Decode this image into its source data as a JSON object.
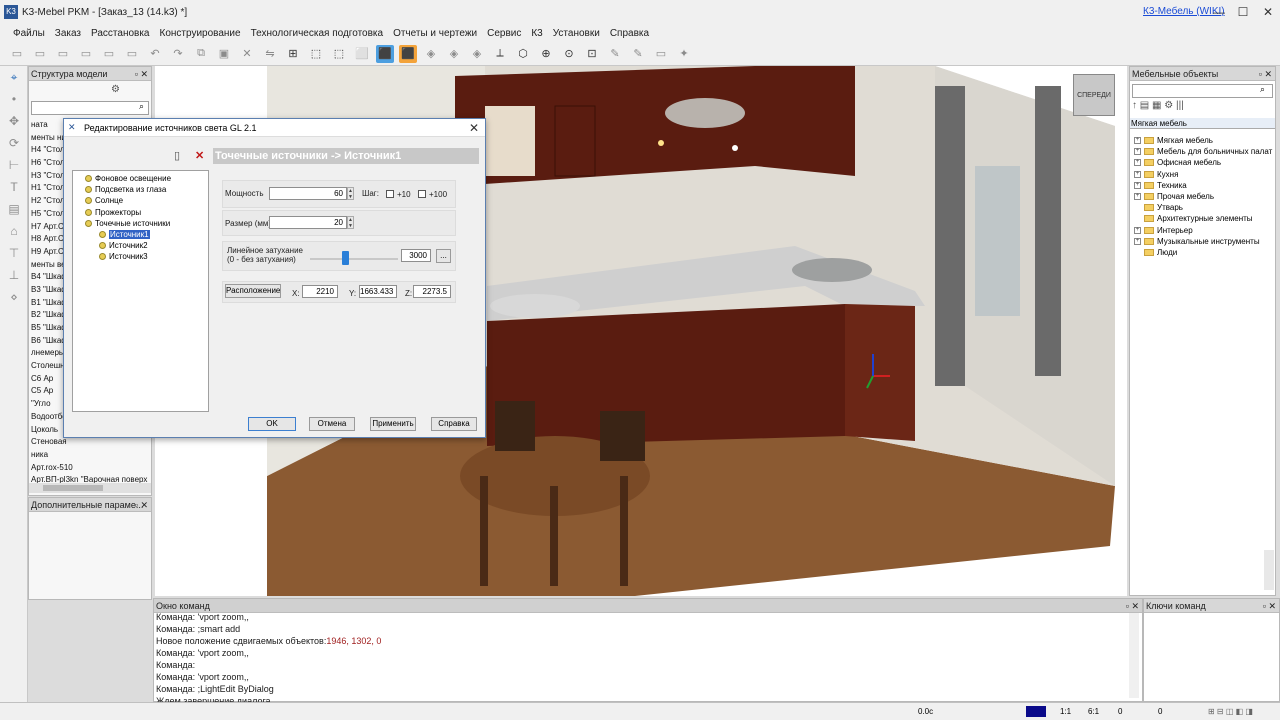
{
  "window": {
    "title": "K3-Mebel PKM - [Заказ_13 (14.k3) *]",
    "wiki_link": "К3-Мебель (WIKI)",
    "controls": [
      "—",
      "☐",
      "✕"
    ]
  },
  "menu": [
    "Файлы",
    "Заказ",
    "Расстановка",
    "Конструирование",
    "Технологическая подготовка",
    "Отчеты и чертежи",
    "Сервис",
    "К3",
    "Установки",
    "Справка"
  ],
  "toolbar_icons": [
    "new-icon",
    "open-icon",
    "save-icon",
    "save-as-icon",
    "print-icon",
    "cut-icon",
    "undo-icon",
    "redo-icon",
    "copy-icon",
    "paste-icon",
    "delete-icon",
    "mirror-icon",
    "grid-icon",
    "box-icon",
    "box-wire-icon",
    "box-solid-icon",
    "box-blue-icon",
    "box-orange-icon",
    "hide-icon",
    "show-icon",
    "layer-icon",
    "axis-icon",
    "cube-view-icon",
    "zoom-icon",
    "zoom-all-icon",
    "zoom-window-icon",
    "brush-icon",
    "pen-icon",
    "sheet-icon",
    "light-icon"
  ],
  "left_tools": [
    "cursor-icon",
    "dot-icon",
    "move-icon",
    "rotate-icon",
    "measure-icon",
    "text-icon",
    "layer-icon",
    "sofa-icon",
    "table-icon",
    "chair-icon",
    "snap-icon"
  ],
  "structure_panel": {
    "title": "Структура модели",
    "items": [
      "ната",
      "менты ни",
      "Н4 \"Стол",
      "Н6 \"Стол",
      "Н3 \"Стол",
      "Н1 \"Стол",
      "Н2 \"Стол",
      "Н5 \"Стол",
      "Н7 Арт.Ст",
      "Н8 Арт.Ст",
      "Н9 Арт.Ст",
      "менты ве",
      "В4 \"Шкаф",
      "В3 \"Шкаф",
      "В1 \"Шкаф",
      "В2 \"Шкаф",
      "В5 \"Шкаф",
      "В6 \"Шкаф",
      "лнемеры",
      "Столешни",
      "С6 Ар",
      "С5 Ар",
      "\"Угло",
      "Водоотбо",
      "Цоколь",
      "Стеновая",
      "ника",
      "Арт.rox-510",
      "Арт.ВП-pl3kn \"Варочная поверх"
    ]
  },
  "add_params_panel": {
    "title": "Дополнительные параме..."
  },
  "right_panel": {
    "title": "Мебельные объекты",
    "current": "Мягкая мебель",
    "items": [
      {
        "label": "Мягкая мебель",
        "expandable": true
      },
      {
        "label": "Мебель для больничных палат",
        "expandable": true
      },
      {
        "label": "Офисная мебель",
        "expandable": true
      },
      {
        "label": "Кухня",
        "expandable": true
      },
      {
        "label": "Техника",
        "expandable": true
      },
      {
        "label": "Прочая мебель",
        "expandable": true
      },
      {
        "label": "Утварь",
        "expandable": false
      },
      {
        "label": "Архитектурные элементы",
        "expandable": false
      },
      {
        "label": "Интерьер",
        "expandable": true
      },
      {
        "label": "Музыкальные инструменты",
        "expandable": true
      },
      {
        "label": "Люди",
        "expandable": false
      }
    ]
  },
  "viewcube": {
    "label": "СПЕРЕДИ"
  },
  "dialog": {
    "title": "Редактирование источников света GL 2.1",
    "header": "Точечные источники -> Источник1",
    "tree": [
      {
        "label": "Фоновое освещение",
        "indent": 0,
        "selected": false
      },
      {
        "label": "Подсветка из глаза",
        "indent": 0,
        "selected": false
      },
      {
        "label": "Солнце",
        "indent": 0,
        "selected": false
      },
      {
        "label": "Прожекторы",
        "indent": 0,
        "selected": false
      },
      {
        "label": "Точечные источники",
        "indent": 0,
        "selected": false
      },
      {
        "label": "Источник1",
        "indent": 1,
        "selected": true
      },
      {
        "label": "Источник2",
        "indent": 1,
        "selected": false
      },
      {
        "label": "Источник3",
        "indent": 1,
        "selected": false
      }
    ],
    "power_label": "Мощность",
    "power_value": "60",
    "step_label": "Шаг:",
    "step10": "+10",
    "step100": "+100",
    "size_label": "Размер (мм):",
    "size_value": "20",
    "attenuation_label_1": "Линейное затухание",
    "attenuation_label_2": "(0 - без затухания)",
    "attenuation_value": "3000",
    "attenuation_fraction": 0.4,
    "browse_label": "...",
    "position_button": "Расположение",
    "x_label": "X:",
    "x_value": "2210",
    "y_label": "Y:",
    "y_value": "1663.433",
    "z_label": "Z:",
    "z_value": "2273.5",
    "buttons": {
      "ok": "OK",
      "cancel": "Отмена",
      "apply": "Применить",
      "help": "Справка"
    }
  },
  "command_window": {
    "title": "Окно команд",
    "lines": [
      {
        "text": "Команда: 'vport zoom,,",
        "hl": ""
      },
      {
        "text": "Команда: ;smart add",
        "hl": ""
      },
      {
        "text": "Новое положение сдвигаемых объектов:",
        "hl": "1946, 1302, 0"
      },
      {
        "text": "Команда: 'vport zoom,,",
        "hl": ""
      },
      {
        "text": "Команда:",
        "hl": ""
      },
      {
        "text": "Команда: 'vport zoom,,",
        "hl": ""
      },
      {
        "text": "Команда: ;LightEdit ByDialog",
        "hl": ""
      },
      {
        "text": "Ждем завершение диалога...",
        "hl": ""
      }
    ]
  },
  "keys_panel": {
    "title": "Ключи команд"
  },
  "status": {
    "zoom": "0.0c",
    "scale1": "1:1",
    "scale2": "6:1",
    "z": "0"
  }
}
